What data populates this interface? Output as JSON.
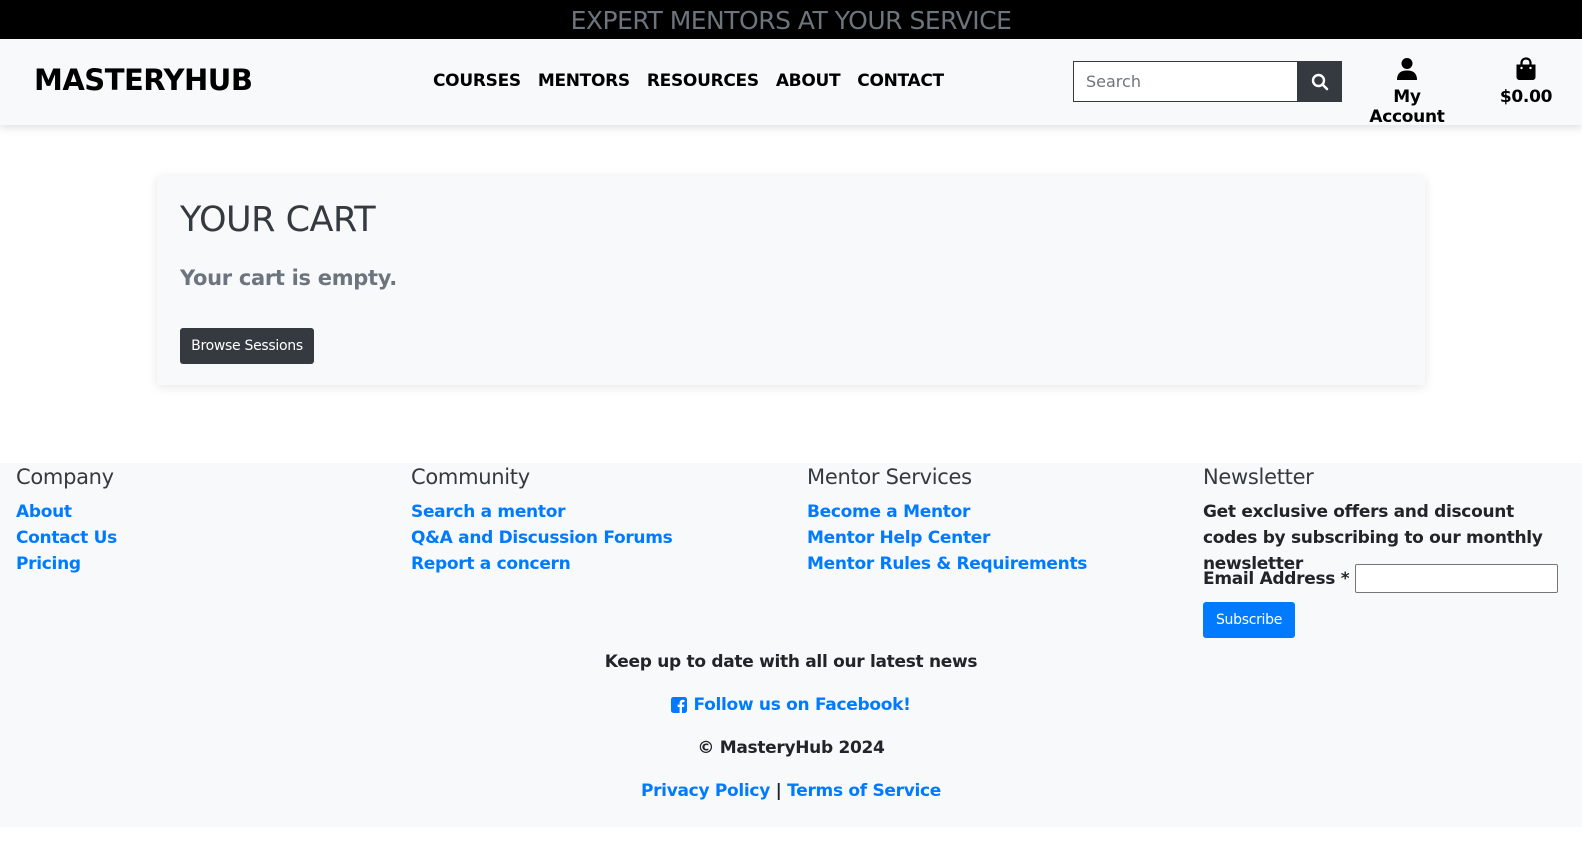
{
  "banner": {
    "text": "EXPERT MENTORS AT YOUR SERVICE"
  },
  "header": {
    "logo": "MASTERYHUB",
    "nav": [
      "COURSES",
      "MENTORS",
      "RESOURCES",
      "ABOUT",
      "CONTACT"
    ],
    "search_placeholder": "Search",
    "account_label": "My Account",
    "cart_total": "$0.00"
  },
  "cart": {
    "title": "YOUR CART",
    "empty_message": "Your cart is empty.",
    "browse_label": "Browse Sessions"
  },
  "footer": {
    "company": {
      "heading": "Company",
      "links": [
        "About",
        "Contact Us",
        "Pricing"
      ]
    },
    "community": {
      "heading": "Community",
      "links": [
        "Search a mentor",
        "Q&A and Discussion Forums",
        "Report a concern"
      ]
    },
    "mentor_services": {
      "heading": "Mentor Services",
      "links": [
        "Become a Mentor",
        "Mentor Help Center",
        "Mentor Rules & Requirements"
      ]
    },
    "newsletter": {
      "heading": "Newsletter",
      "text": "Get exclusive offers and discount codes by subscribing to our monthly newsletter",
      "email_label": "Email Address *",
      "subscribe_label": "Subscribe"
    },
    "news_text": "Keep up to date with all our latest news",
    "facebook_label": "Follow us on Facebook!",
    "copyright": "© MasteryHub 2024",
    "privacy_label": "Privacy Policy",
    "separator": "|",
    "terms_label": "Terms of Service"
  },
  "colors": {
    "link_blue": "#007bff",
    "dark_button": "#343a40",
    "banner_bg": "#000000",
    "light_bg": "#f8f9fa"
  },
  "icons": [
    "search-icon",
    "user-icon",
    "shopping-bag-icon",
    "facebook-icon"
  ]
}
